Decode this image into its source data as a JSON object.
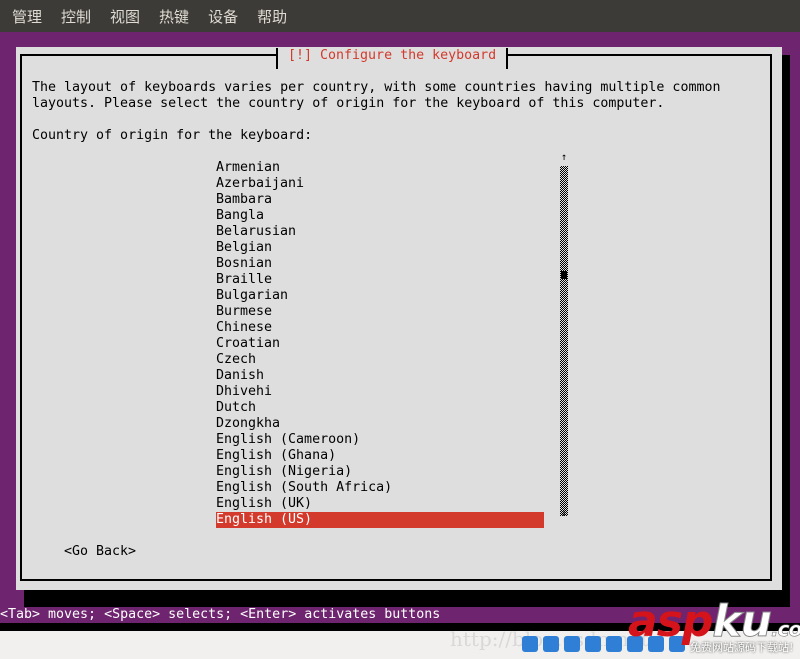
{
  "menubar": {
    "items": [
      "管理",
      "控制",
      "视图",
      "热键",
      "设备",
      "帮助"
    ]
  },
  "dialog": {
    "title": "[!] Configure the keyboard",
    "description": "The layout of keyboards varies per country, with some countries having multiple common\nlayouts. Please select the country of origin for the keyboard of this computer.",
    "prompt": "Country of origin for the keyboard:",
    "countries": [
      "Armenian",
      "Azerbaijani",
      "Bambara",
      "Bangla",
      "Belarusian",
      "Belgian",
      "Bosnian",
      "Braille",
      "Bulgarian",
      "Burmese",
      "Chinese",
      "Croatian",
      "Czech",
      "Danish",
      "Dhivehi",
      "Dutch",
      "Dzongkha",
      "English (Cameroon)",
      "English (Ghana)",
      "English (Nigeria)",
      "English (South Africa)",
      "English (UK)",
      "English (US)"
    ],
    "selected": "English (US)",
    "scroll_position_percent": 30,
    "go_back": "<Go Back>"
  },
  "status_line": "<Tab> moves; <Space> selects; <Enter> activates buttons",
  "watermark": "http://blog.csdn.net",
  "logo": {
    "main": "asp",
    "accent": "ku",
    ".com": ".com",
    "sub": "免费网站源码下载站!"
  },
  "colors": {
    "background": "#6f246f",
    "dialog": "#dedede",
    "accent": "#d33a2c",
    "menubar": "#3c3b37"
  }
}
